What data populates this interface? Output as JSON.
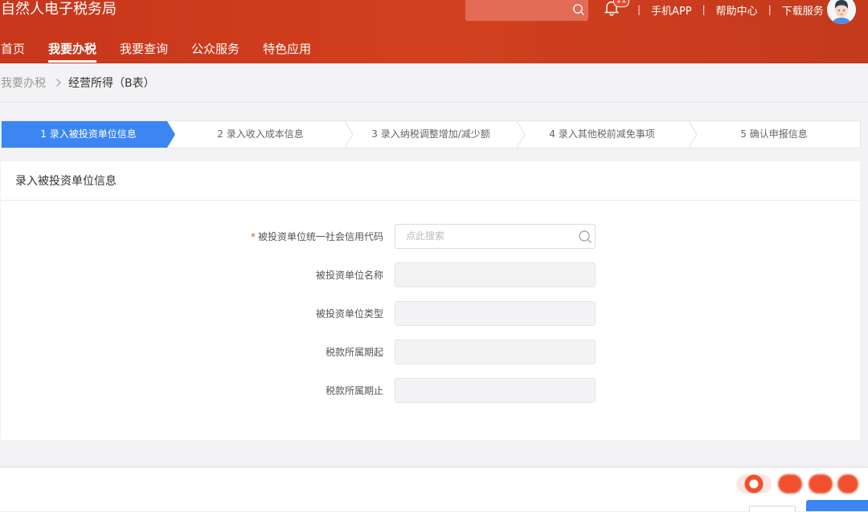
{
  "header": {
    "site_title": "自然人电子税务局",
    "notification_count": "11",
    "links": [
      "手机APP",
      "帮助中心",
      "下载服务"
    ],
    "separator": "|"
  },
  "nav": {
    "items": [
      {
        "label": "首页",
        "active": false
      },
      {
        "label": "我要办税",
        "active": true
      },
      {
        "label": "我要查询",
        "active": false
      },
      {
        "label": "公众服务",
        "active": false
      },
      {
        "label": "特色应用",
        "active": false
      }
    ]
  },
  "breadcrumb": {
    "parent": "我要办税",
    "current": "经营所得（B表）"
  },
  "steps": [
    {
      "label": "1  录入被投资单位信息",
      "active": true
    },
    {
      "label": "2  录入收入成本信息",
      "active": false
    },
    {
      "label": "3  录入纳税调整增加/减少额",
      "active": false
    },
    {
      "label": "4  录入其他税前减免事项",
      "active": false
    },
    {
      "label": "5  确认申报信息",
      "active": false
    }
  ],
  "panel": {
    "title": "录入被投资单位信息",
    "fields": [
      {
        "label": "被投资单位统一社会信用代码",
        "required": true,
        "placeholder": "点此搜索",
        "value": ""
      },
      {
        "label": "被投资单位名称",
        "required": false,
        "value": ""
      },
      {
        "label": "被投资单位类型",
        "required": false,
        "value": ""
      },
      {
        "label": "税款所属期起",
        "required": false,
        "value": ""
      },
      {
        "label": "税款所属期止",
        "required": false,
        "value": ""
      }
    ]
  },
  "colors": {
    "header_red": "#c8361b",
    "active_step_blue": "#3b86f2",
    "required_star": "#e84d32"
  },
  "icons": [
    "search-icon",
    "bell-icon",
    "avatar-icon",
    "chevron-right-icon"
  ]
}
